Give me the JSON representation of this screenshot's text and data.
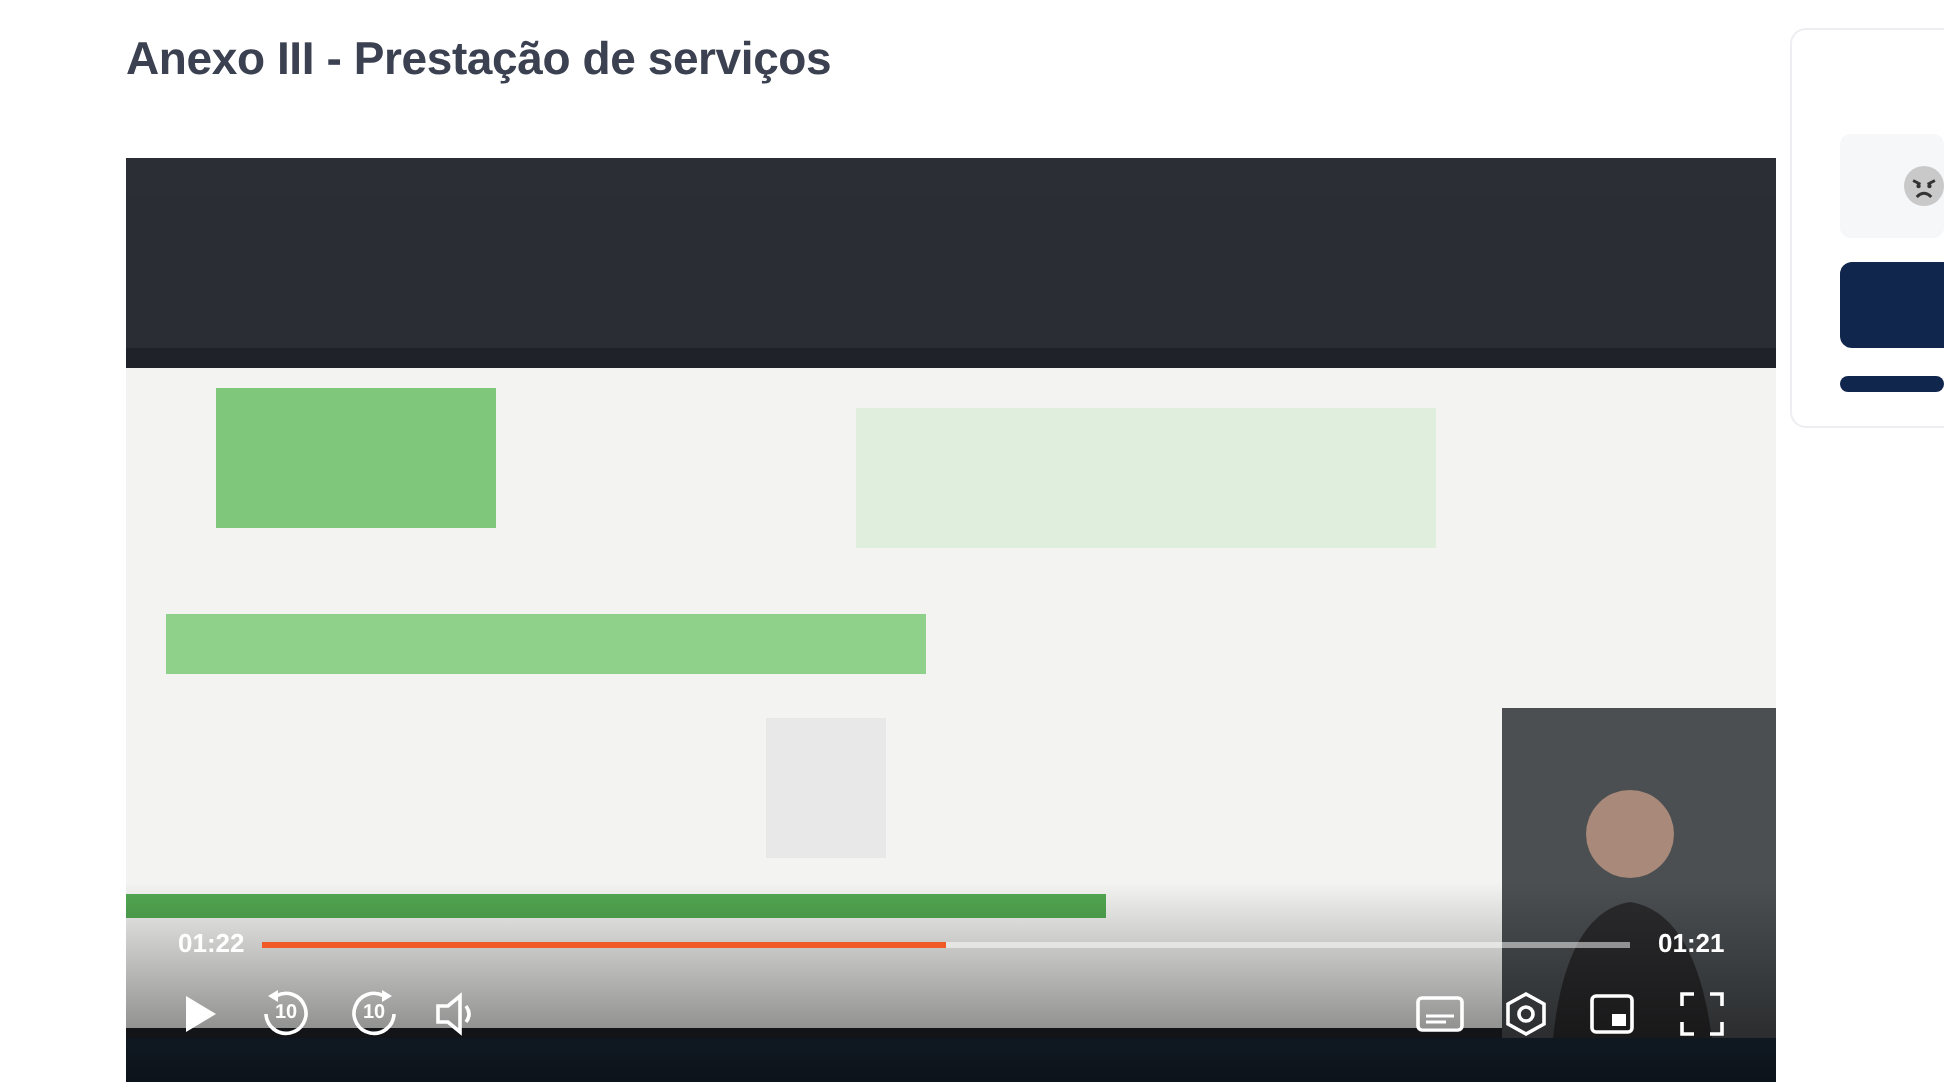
{
  "page": {
    "title": "Anexo III - Prestação de serviços"
  },
  "video": {
    "kind": "picture",
    "elapsed": "01:22",
    "remaining": "01:21",
    "level": 0.5,
    "rewind_seconds": "10",
    "forward_seconds": "10"
  }
}
